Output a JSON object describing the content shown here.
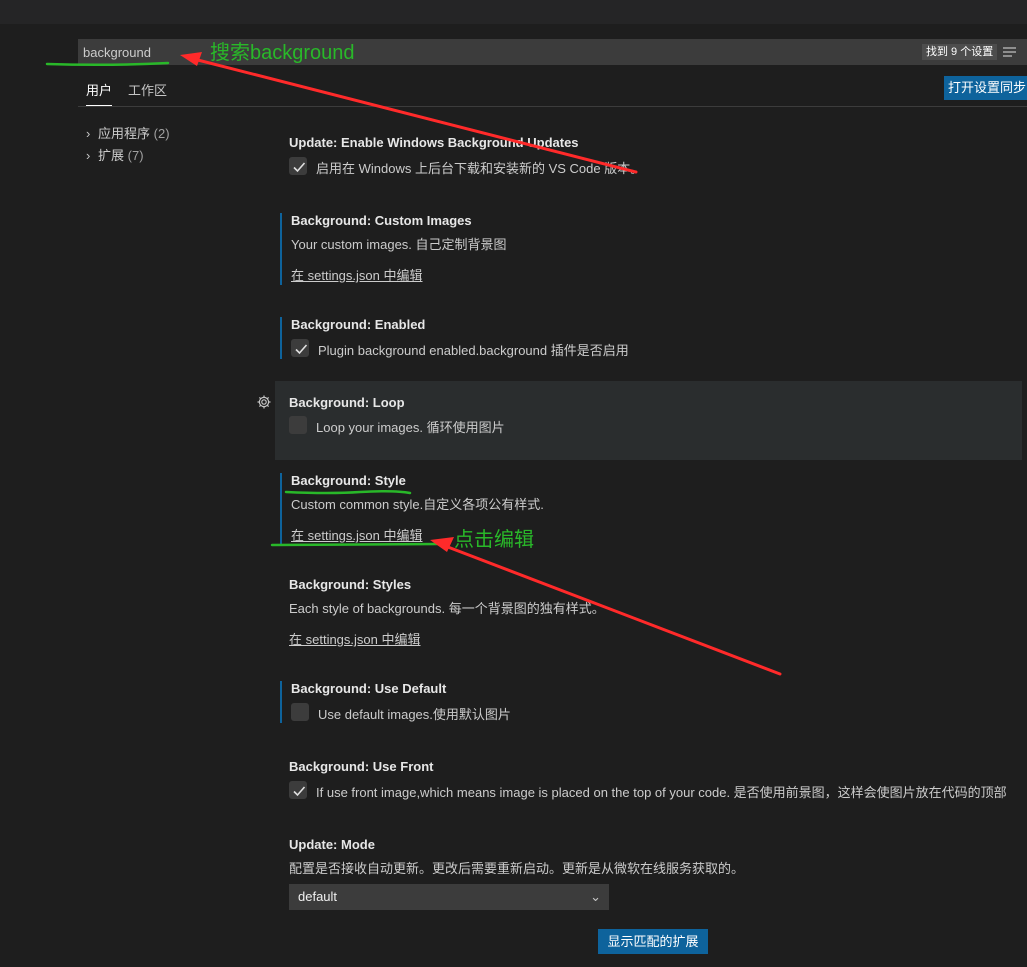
{
  "search": {
    "value": "background",
    "result_count": "找到 9 个设置",
    "filter_icon": "filter-lines-icon"
  },
  "tabs": [
    {
      "label": "用户",
      "active": true
    },
    {
      "label": "工作区",
      "active": false
    }
  ],
  "sync_button": "打开设置同步",
  "tree": [
    {
      "label": "应用程序",
      "count": "(2)"
    },
    {
      "label": "扩展",
      "count": "(7)"
    }
  ],
  "settings": [
    {
      "category": "Update: ",
      "name": "Enable Windows Background Updates",
      "checkbox": true,
      "checked": true,
      "description": "启用在 Windows 上后台下载和安装新的 VS Code 版本。"
    },
    {
      "category": "Background: ",
      "name": "Custom Images",
      "description": "Your custom images. 自己定制背景图",
      "edit_link": "在 settings.json 中编辑"
    },
    {
      "category": "Background: ",
      "name": "Enabled",
      "checkbox": true,
      "checked": true,
      "description": "Plugin background enabled.background 插件是否启用"
    },
    {
      "category": "Background: ",
      "name": "Loop",
      "checkbox": true,
      "checked": false,
      "description": "Loop your images. 循环使用图片"
    },
    {
      "category": "Background: ",
      "name": "Style",
      "description": "Custom common style.自定义各项公有样式.",
      "edit_link": "在 settings.json 中编辑"
    },
    {
      "category": "Background: ",
      "name": "Styles",
      "description": "Each style of backgrounds. 每一个背景图的独有样式。",
      "edit_link": "在 settings.json 中编辑"
    },
    {
      "category": "Background: ",
      "name": "Use Default",
      "checkbox": true,
      "checked": false,
      "description": "Use default images.使用默认图片"
    },
    {
      "category": "Background: ",
      "name": "Use Front",
      "checkbox": true,
      "checked": true,
      "description": "If use front image,which means image is placed on the top of your code. 是否使用前景图，这样会使图片放在代码的顶部"
    },
    {
      "category": "Update: ",
      "name": "Mode",
      "description": "配置是否接收自动更新。更改后需要重新启动。更新是从微软在线服务获取的。",
      "select_value": "default"
    }
  ],
  "ext_button": "显示匹配的扩展",
  "annotations": {
    "search_note": "搜索background",
    "edit_note": "点击编辑",
    "color": "#29b829",
    "arrow_color": "#ff2a2a"
  }
}
